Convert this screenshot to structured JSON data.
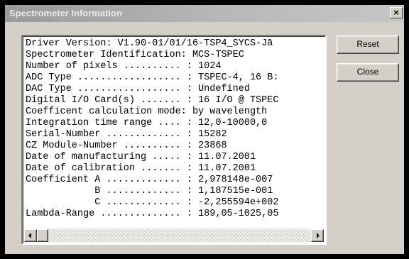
{
  "window": {
    "title": "Spectrometer Information",
    "close_glyph": "×"
  },
  "buttons": {
    "reset_label": "Reset",
    "close_label": "Close"
  },
  "info_lines": [
    "Driver Version: V1.90-01/01/16-TSP4_SYCS-Jā",
    "Spectrometer Identification: MCS-TSPEC",
    "Number of pixels .......... : 1024",
    "ADC Type .................. : TSPEC-4, 16 B:",
    "DAC Type .................. : Undefined",
    "Digital I/O Card(s) ....... : 16 I/O @ TSPEC",
    "Coefficent calculation mode: by wavelength",
    "Integration time range .... : 12,0-10000,0",
    "Serial-Number ............. : 15282",
    "CZ Module-Number .......... : 23868",
    "Date of manufacturing ..... : 11.07.2001",
    "Date of calibration ....... : 11.07.2001",
    "Coefficient A ............. : 2,978148e-007",
    "            B ............. : 1,187515e-001",
    "            C ............. : -2,255594e+002",
    "Lambda-Range .............. : 189,05-1025,05"
  ],
  "icons": {
    "scroll_left": "left-arrow-icon",
    "scroll_right": "right-arrow-icon",
    "close": "close-icon"
  }
}
